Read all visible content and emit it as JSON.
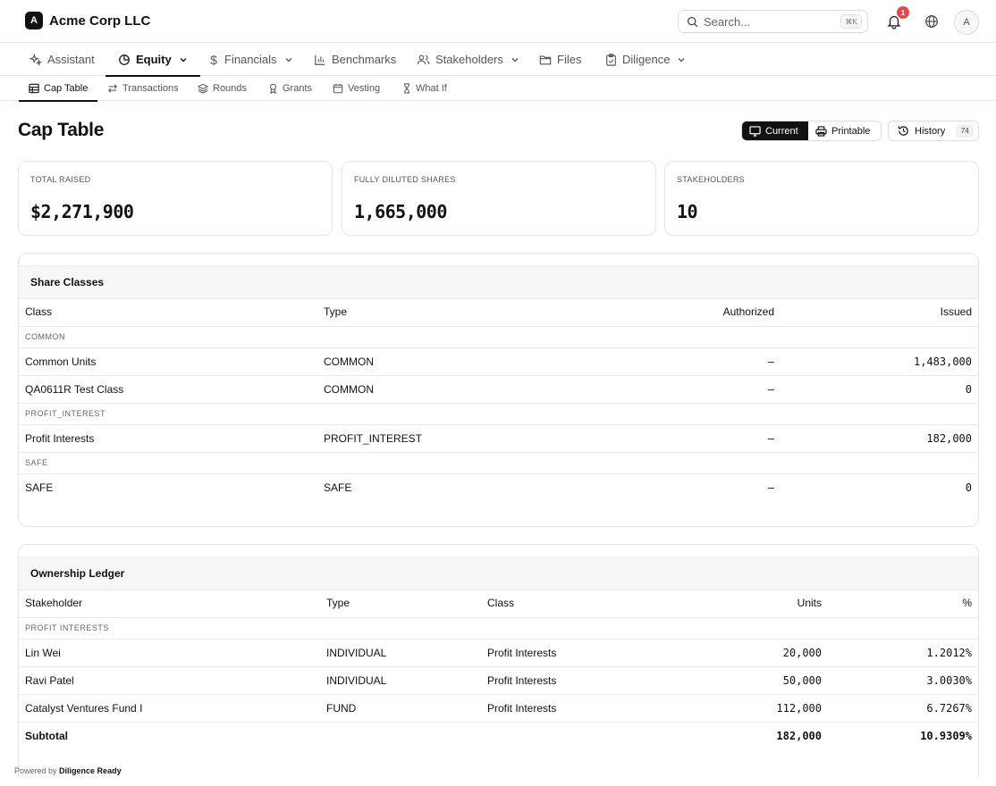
{
  "app": {
    "logo_letter": "A",
    "company": "Acme Corp LLC",
    "search_placeholder": "Search...",
    "search_shortcut": "⌘K",
    "notification_count": "1",
    "avatar_letter": "A"
  },
  "nav": {
    "items": [
      {
        "label": "Assistant",
        "icon": "sparkles-icon"
      },
      {
        "label": "Equity",
        "icon": "pie-chart-icon",
        "active": true
      },
      {
        "label": "Financials",
        "icon": "dollar-icon"
      },
      {
        "label": "Benchmarks",
        "icon": "bar-chart-icon"
      },
      {
        "label": "Stakeholders",
        "icon": "users-icon"
      },
      {
        "label": "Files",
        "icon": "folder-icon"
      },
      {
        "label": "Diligence",
        "icon": "clipboard-check-icon"
      }
    ]
  },
  "subnav": {
    "items": [
      {
        "label": "Cap Table",
        "icon": "table-icon",
        "active": true
      },
      {
        "label": "Transactions",
        "icon": "arrows-icon"
      },
      {
        "label": "Rounds",
        "icon": "layers-icon"
      },
      {
        "label": "Grants",
        "icon": "award-icon"
      },
      {
        "label": "Vesting",
        "icon": "calendar-icon"
      },
      {
        "label": "What If",
        "icon": "hourglass-icon"
      }
    ]
  },
  "page": {
    "title": "Cap Table",
    "view_current": "Current",
    "view_printable": "Printable",
    "history_label": "History",
    "history_count": "74"
  },
  "stats": [
    {
      "label": "TOTAL RAISED",
      "value": "$2,271,900"
    },
    {
      "label": "FULLY DILUTED SHARES",
      "value": "1,665,000"
    },
    {
      "label": "STAKEHOLDERS",
      "value": "10"
    }
  ],
  "share_classes": {
    "title": "Share Classes",
    "columns": [
      "Class",
      "Type",
      "Authorized",
      "Issued"
    ],
    "groups": [
      {
        "name": "COMMON",
        "rows": [
          {
            "class": "Common Units",
            "type": "COMMON",
            "authorized": "–",
            "issued": "1,483,000"
          },
          {
            "class": "QA0611R Test Class",
            "type": "COMMON",
            "authorized": "–",
            "issued": "0"
          }
        ]
      },
      {
        "name": "PROFIT_INTEREST",
        "rows": [
          {
            "class": "Profit Interests",
            "type": "PROFIT_INTEREST",
            "authorized": "–",
            "issued": "182,000"
          }
        ]
      },
      {
        "name": "SAFE",
        "rows": [
          {
            "class": "SAFE",
            "type": "SAFE",
            "authorized": "–",
            "issued": "0"
          }
        ]
      }
    ]
  },
  "ledger": {
    "title": "Ownership Ledger",
    "columns": [
      "Stakeholder",
      "Type",
      "Class",
      "Units",
      "%"
    ],
    "group": "PROFIT INTERESTS",
    "rows": [
      {
        "stakeholder": "Lin Wei",
        "type": "INDIVIDUAL",
        "class": "Profit Interests",
        "units": "20,000",
        "pct": "1.2012%"
      },
      {
        "stakeholder": "Ravi Patel",
        "type": "INDIVIDUAL",
        "class": "Profit Interests",
        "units": "50,000",
        "pct": "3.0030%"
      },
      {
        "stakeholder": "Catalyst Ventures Fund I",
        "type": "FUND",
        "class": "Profit Interests",
        "units": "112,000",
        "pct": "6.7267%"
      }
    ],
    "subtotal": {
      "label": "Subtotal",
      "units": "182,000",
      "pct": "10.9309%"
    }
  },
  "footer": {
    "prefix": "Powered by",
    "brand": "Diligence Ready"
  }
}
